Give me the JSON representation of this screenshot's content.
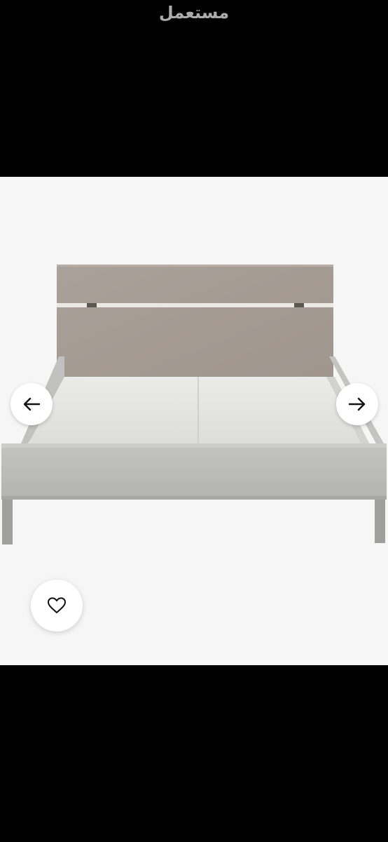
{
  "watermark": {
    "text": "مستعمل"
  },
  "gallery": {
    "prev_icon": "arrow-left-icon",
    "next_icon": "arrow-right-icon",
    "favorite_icon": "heart-outline-icon"
  },
  "colors": {
    "background_black": "#000000",
    "image_background": "#f6f6f6",
    "button_background": "#ffffff",
    "icon_color": "#111111",
    "headboard_wood": "#a89f97",
    "bed_frame_grey": "#b9bab8",
    "mattress_base": "#e8e8e7"
  }
}
